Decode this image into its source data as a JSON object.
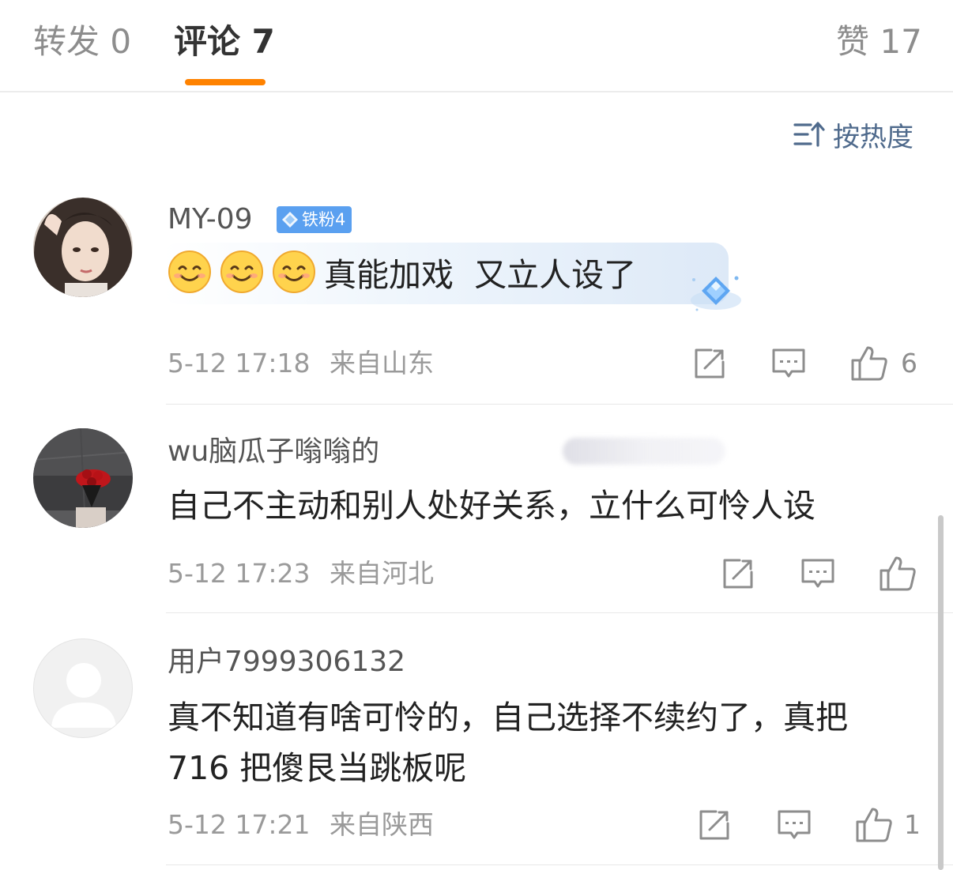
{
  "tabs": {
    "repost": "转发 0",
    "comments": "评论 7",
    "likes": "赞 17"
  },
  "sort": {
    "label": "按热度",
    "icon": "sort-icon"
  },
  "colors": {
    "accent": "#ff8200",
    "sort_text": "#4f6a8c",
    "badge": "#5aa0f0"
  },
  "comments": [
    {
      "username": "MY-09",
      "badge": "铁粉4",
      "emojis": [
        "smile-emoji",
        "smile-emoji",
        "smile-emoji"
      ],
      "text": "真能加戏  又立人设了",
      "time": "5-12 17:18",
      "location": "来自山东",
      "likes": "6"
    },
    {
      "username": "wu脑瓜子嗡嗡的",
      "text": "自己不主动和别人处好关系，立什么可怜人设",
      "time": "5-12 17:23",
      "location": "来自河北",
      "likes": ""
    },
    {
      "username": "用户7999306132",
      "text_line1": "真不知道有啥可怜的，自己选择不续约了，真把",
      "text_line2": "716 把傻艮当跳板呢",
      "time": "5-12 17:21",
      "location": "来自陕西",
      "likes": "1"
    }
  ]
}
